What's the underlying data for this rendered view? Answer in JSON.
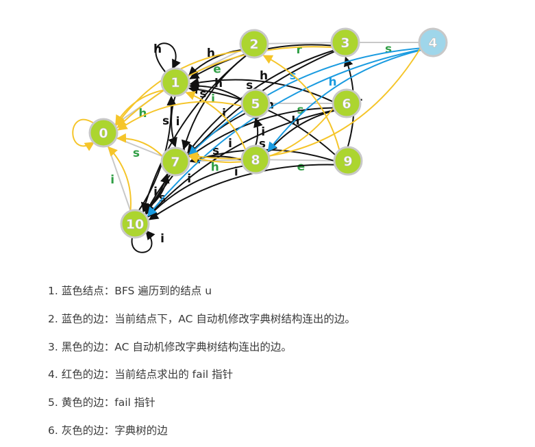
{
  "colors": {
    "node_fill": "#acd52f",
    "node_current_fill": "#9fd6ea",
    "blue": "#1a9be0",
    "black": "#111111",
    "yellow": "#f5c52a",
    "gray": "#c8c8c8",
    "label_green": "#2f9e44"
  },
  "diagram": {
    "nodes": [
      {
        "id": "0",
        "label": "0",
        "current": false
      },
      {
        "id": "1",
        "label": "1",
        "current": false
      },
      {
        "id": "2",
        "label": "2",
        "current": false
      },
      {
        "id": "3",
        "label": "3",
        "current": false
      },
      {
        "id": "4",
        "label": "4",
        "current": true
      },
      {
        "id": "5",
        "label": "5",
        "current": false
      },
      {
        "id": "6",
        "label": "6",
        "current": false
      },
      {
        "id": "7",
        "label": "7",
        "current": false
      },
      {
        "id": "8",
        "label": "8",
        "current": false
      },
      {
        "id": "9",
        "label": "9",
        "current": false
      },
      {
        "id": "10",
        "label": "10",
        "current": false
      }
    ],
    "edges": [
      {
        "from": "0",
        "to": "1",
        "label": "h",
        "kind": "gray"
      },
      {
        "from": "0",
        "to": "7",
        "label": "s",
        "kind": "gray"
      },
      {
        "from": "0",
        "to": "10",
        "label": "i",
        "kind": "gray"
      },
      {
        "from": "1",
        "to": "2",
        "label": "e",
        "kind": "gray"
      },
      {
        "from": "2",
        "to": "3",
        "label": "r",
        "kind": "gray"
      },
      {
        "from": "3",
        "to": "4",
        "label": "s",
        "kind": "gray"
      },
      {
        "from": "1",
        "to": "5",
        "label": "i",
        "kind": "gray"
      },
      {
        "from": "5",
        "to": "6",
        "label": "s",
        "kind": "gray"
      },
      {
        "from": "7",
        "to": "8",
        "label": "h",
        "kind": "gray"
      },
      {
        "from": "8",
        "to": "9",
        "label": "e",
        "kind": "gray"
      },
      {
        "from": "1",
        "to": "1",
        "label": "h",
        "kind": "black"
      },
      {
        "from": "10",
        "to": "10",
        "label": "i",
        "kind": "black"
      },
      {
        "from": "2",
        "to": "1",
        "label": "h",
        "kind": "black"
      },
      {
        "from": "3",
        "to": "1",
        "label": "h",
        "kind": "black"
      },
      {
        "from": "5",
        "to": "1",
        "label": "h",
        "kind": "black"
      },
      {
        "from": "6",
        "to": "1",
        "label": "h",
        "kind": "black"
      },
      {
        "from": "9",
        "to": "1",
        "label": "h",
        "kind": "black"
      },
      {
        "from": "1",
        "to": "7",
        "label": "s",
        "kind": "black"
      },
      {
        "from": "10",
        "to": "1",
        "label": "h",
        "kind": "black"
      },
      {
        "from": "10",
        "to": "7",
        "label": "s",
        "kind": "black"
      },
      {
        "from": "7",
        "to": "10",
        "label": "i",
        "kind": "black"
      },
      {
        "from": "8",
        "to": "5",
        "label": "i",
        "kind": "black"
      },
      {
        "from": "6",
        "to": "8",
        "label": "h",
        "kind": "black"
      },
      {
        "from": "9",
        "to": "3",
        "label": "r",
        "kind": "black"
      },
      {
        "from": "2",
        "to": "7",
        "label": "s",
        "kind": "black"
      },
      {
        "from": "3",
        "to": "7",
        "label": "s",
        "kind": "black"
      },
      {
        "from": "6",
        "to": "7",
        "label": "s",
        "kind": "black"
      },
      {
        "from": "8",
        "to": "7",
        "label": "s",
        "kind": "black"
      },
      {
        "from": "9",
        "to": "7",
        "label": "s",
        "kind": "black"
      },
      {
        "from": "2",
        "to": "10",
        "label": "i",
        "kind": "black"
      },
      {
        "from": "3",
        "to": "10",
        "label": "i",
        "kind": "black"
      },
      {
        "from": "5",
        "to": "10",
        "label": "i",
        "kind": "black"
      },
      {
        "from": "6",
        "to": "10",
        "label": "i",
        "kind": "black"
      },
      {
        "from": "9",
        "to": "10",
        "label": "i",
        "kind": "black"
      },
      {
        "from": "8",
        "to": "10",
        "label": "i",
        "kind": "black"
      },
      {
        "from": "4",
        "to": "7",
        "label": "s",
        "kind": "blue"
      },
      {
        "from": "4",
        "to": "8",
        "label": "h",
        "kind": "blue"
      },
      {
        "from": "4",
        "to": "10",
        "label": "i",
        "kind": "blue"
      },
      {
        "from": "0",
        "to": "0",
        "label": "",
        "kind": "yellow"
      },
      {
        "from": "1",
        "to": "0",
        "label": "",
        "kind": "yellow"
      },
      {
        "from": "2",
        "to": "0",
        "label": "",
        "kind": "yellow"
      },
      {
        "from": "3",
        "to": "0",
        "label": "",
        "kind": "yellow"
      },
      {
        "from": "4",
        "to": "7",
        "label": "",
        "kind": "yellow"
      },
      {
        "from": "5",
        "to": "0",
        "label": "",
        "kind": "yellow"
      },
      {
        "from": "6",
        "to": "7",
        "label": "",
        "kind": "yellow"
      },
      {
        "from": "7",
        "to": "0",
        "label": "",
        "kind": "yellow"
      },
      {
        "from": "8",
        "to": "1",
        "label": "",
        "kind": "yellow"
      },
      {
        "from": "9",
        "to": "2",
        "label": "",
        "kind": "yellow"
      },
      {
        "from": "10",
        "to": "0",
        "label": "",
        "kind": "yellow"
      }
    ]
  },
  "legend": {
    "items": [
      {
        "number": "1.",
        "text": "蓝色结点：BFS 遍历到的结点 u"
      },
      {
        "number": "2.",
        "text": "蓝色的边：当前结点下，AC 自动机修改字典树结构连出的边。"
      },
      {
        "number": "3.",
        "text": "黑色的边：AC 自动机修改字典树结构连出的边。"
      },
      {
        "number": "4.",
        "text": "红色的边：当前结点求出的 fail 指针"
      },
      {
        "number": "5.",
        "text": "黄色的边：fail 指针"
      },
      {
        "number": "6.",
        "text": "灰色的边：字典树的边"
      }
    ]
  }
}
